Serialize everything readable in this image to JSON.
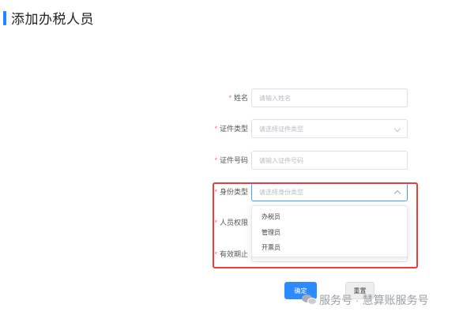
{
  "page": {
    "title": "添加办税人员"
  },
  "form": {
    "fields": [
      {
        "label": "姓名",
        "required": "*",
        "placeholder": "请输入姓名",
        "type": "input"
      },
      {
        "label": "证件类型",
        "required": "*",
        "placeholder": "请选择证件类型",
        "type": "select"
      },
      {
        "label": "证件号码",
        "required": "*",
        "placeholder": "请输入证件号码",
        "type": "input"
      },
      {
        "label": "身份类型",
        "required": "*",
        "placeholder": "请选择身份类型",
        "type": "select",
        "state": "open"
      },
      {
        "label": "人员权限",
        "required": "*"
      },
      {
        "label": "有效期止",
        "required": "*"
      }
    ],
    "dropdown_options": [
      "办税员",
      "管理员",
      "开票员"
    ]
  },
  "buttons": {
    "confirm": "确定",
    "reset": "重置"
  },
  "watermark": {
    "text": "服务号 · 慧算账服务号"
  },
  "colors": {
    "accent": "#1e88ff",
    "primary_button": "#2e8bff",
    "required_mark": "#f56c6c",
    "highlight": "#ee3b3b"
  },
  "icons": {
    "select_arrow": "chevron-down-icon",
    "open_select_arrow": "chevron-up-icon",
    "watermark": "wechat-icon"
  }
}
